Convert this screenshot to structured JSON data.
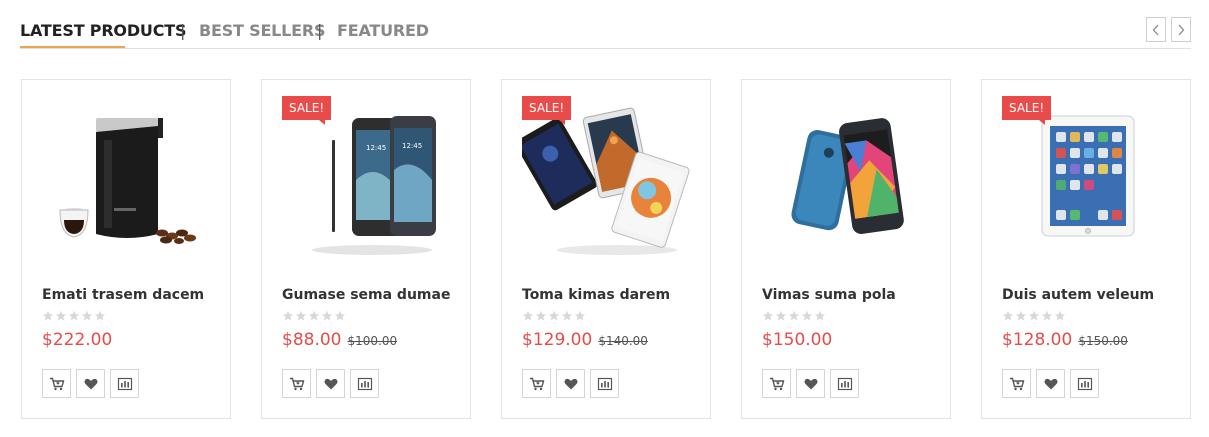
{
  "tabs": [
    {
      "label": "LATEST PRODUCTS",
      "active": true
    },
    {
      "label": "BEST SELLERS",
      "active": false
    },
    {
      "label": "FEATURED",
      "active": false
    }
  ],
  "separator": "|",
  "colors": {
    "accent": "#f0a34a",
    "price": "#e94b4b",
    "sale_badge": "#e94b4b"
  },
  "products": [
    {
      "name": "Emati trasem dacem",
      "price": "$222.00",
      "old_price": "",
      "sale": "",
      "image": "coffee-grinder",
      "rating": 0
    },
    {
      "name": "Gumase sema dumae",
      "price": "$88.00",
      "old_price": "$100.00",
      "sale": "SALE!",
      "image": "galaxy-note-phones",
      "rating": 0
    },
    {
      "name": "Toma kimas darem",
      "price": "$129.00",
      "old_price": "$140.00",
      "sale": "SALE!",
      "image": "ipad-mini-tablets",
      "rating": 0
    },
    {
      "name": "Vimas suma pola",
      "price": "$150.00",
      "old_price": "",
      "sale": "",
      "image": "galaxy-s5-phone",
      "rating": 0
    },
    {
      "name": "Duis autem veleum",
      "price": "$128.00",
      "old_price": "$150.00",
      "sale": "SALE!",
      "image": "white-ipad",
      "rating": 0
    }
  ],
  "icons": {
    "prev": "chevron-left-icon",
    "next": "chevron-right-icon",
    "cart": "cart-icon",
    "wishlist": "heart-icon",
    "compare": "compare-icon",
    "star": "star-icon"
  }
}
